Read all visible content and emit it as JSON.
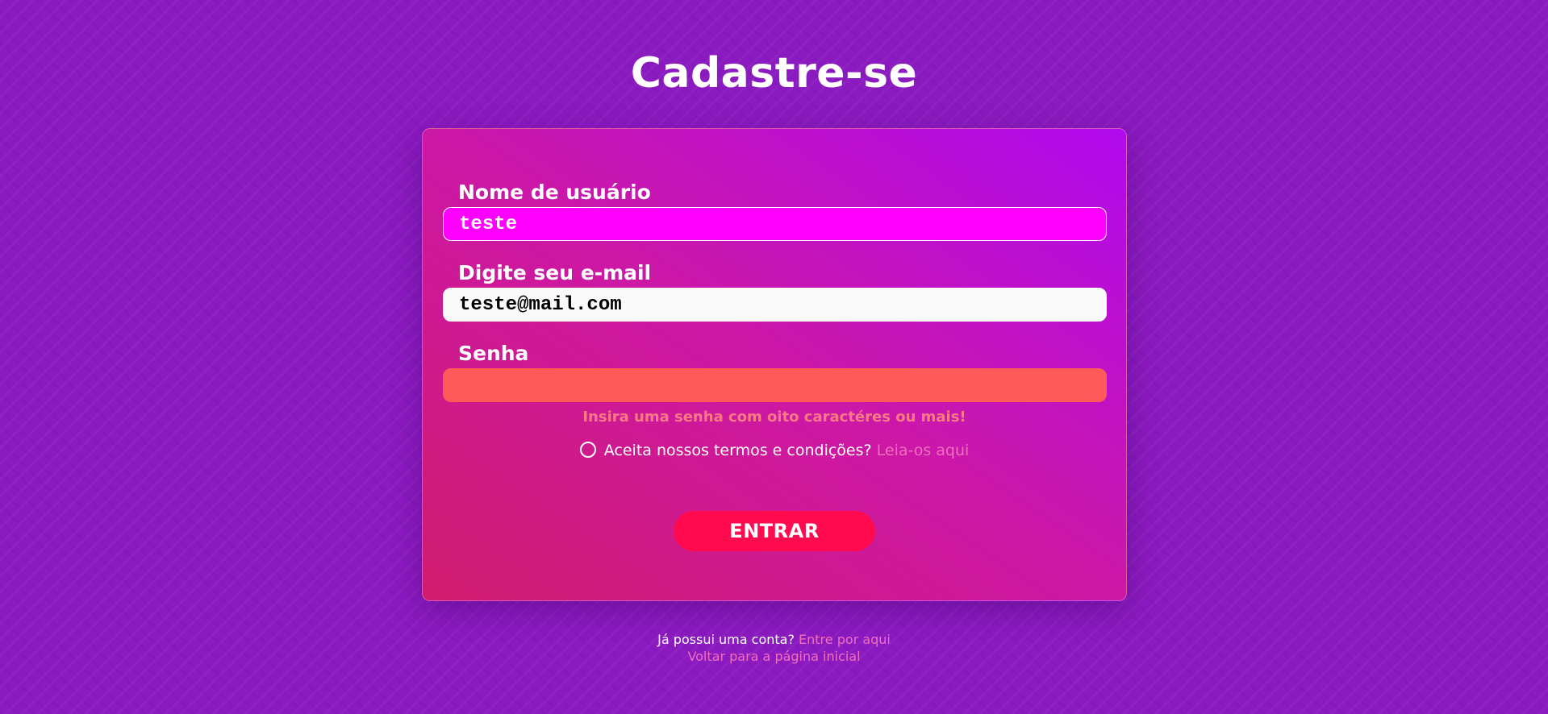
{
  "page": {
    "title": "Cadastre-se"
  },
  "form": {
    "username": {
      "label": "Nome de usuário",
      "value": "teste"
    },
    "email": {
      "label": "Digite seu e-mail",
      "value": "teste@mail.com"
    },
    "password": {
      "label": "Senha",
      "value": ""
    },
    "error_message": "Insira uma senha com oito caractéres ou mais!",
    "terms": {
      "question": "Aceita nossos termos e condições?",
      "link_text": "Leia-os aqui",
      "checked": false
    },
    "submit_label": "ENTRAR"
  },
  "footer": {
    "login_prompt": "Já possui uma conta?",
    "login_link": "Entre por aqui",
    "home_link": "Voltar para a página inicial"
  },
  "colors": {
    "background": "#8b1ac0",
    "username_field": "#ff00ff",
    "password_field_error": "#ff5a5a",
    "submit_button": "#ff0a4f",
    "link": "#f06fbd",
    "error_text": "#ff7a86"
  }
}
